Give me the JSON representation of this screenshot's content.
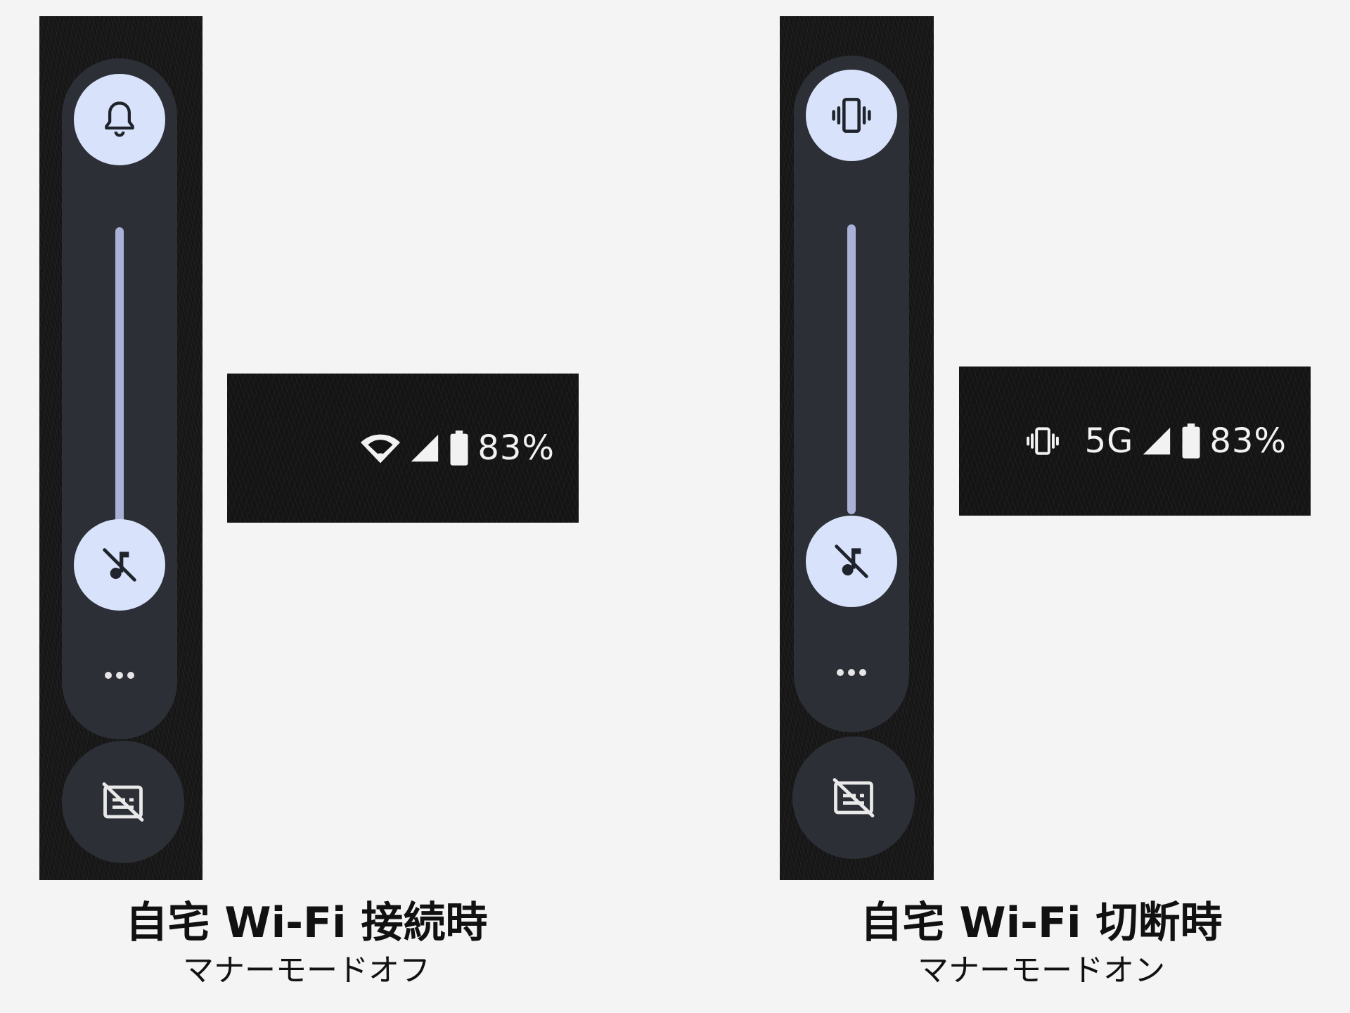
{
  "left_panel": {
    "top_icon": "bell-icon",
    "thumb_icon": "music-note-off-icon",
    "more_icon": "more-horiz-icon",
    "bottom_icon": "captions-off-icon",
    "status": {
      "icons": [
        "wifi-icon",
        "cell-signal-icon",
        "battery-icon"
      ],
      "battery": "83%"
    },
    "caption": {
      "title": "自宅 Wi-Fi 接続時",
      "subtitle": "マナーモードオフ"
    }
  },
  "right_panel": {
    "top_icon": "vibrate-icon",
    "thumb_icon": "music-note-off-icon",
    "more_icon": "more-horiz-icon",
    "bottom_icon": "captions-off-icon",
    "status": {
      "icons": [
        "vibrate-icon",
        "cell-signal-icon",
        "battery-icon"
      ],
      "network": "5G",
      "battery": "83%"
    },
    "caption": {
      "title": "自宅 Wi-Fi 切断時",
      "subtitle": "マナーモードオン"
    }
  },
  "colors": {
    "panel_bg": "#2c2f36",
    "button_bg": "#d8e3fb",
    "track": "#a9b1d6",
    "page_bg": "#f4f4f4"
  }
}
